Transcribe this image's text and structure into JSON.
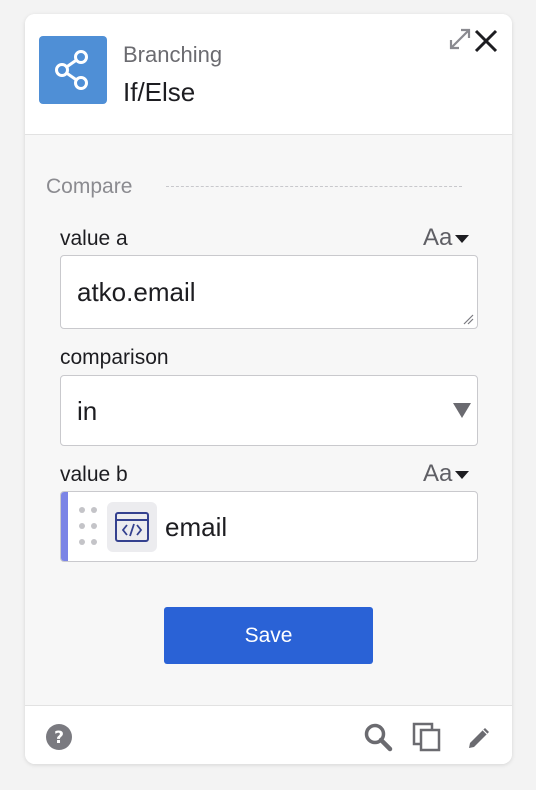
{
  "header": {
    "icon": "share-icon",
    "subtitle": "Branching",
    "title": "If/Else",
    "expand_icon": "expand-icon",
    "close_icon": "close-icon"
  },
  "section": {
    "label": "Compare"
  },
  "fields": {
    "value_a": {
      "label": "value a",
      "type_toggle": "Aa",
      "value": "atko.email"
    },
    "comparison": {
      "label": "comparison",
      "selected": "in"
    },
    "value_b": {
      "label": "value b",
      "type_toggle": "Aa",
      "token_icon": "code-icon",
      "token_label": "email",
      "accent_color": "#7b84e6"
    }
  },
  "actions": {
    "save_label": "Save",
    "save_color": "#2a62d6"
  },
  "footer": {
    "icons": [
      "help-icon",
      "search-icon",
      "copy-icon",
      "edit-icon"
    ]
  },
  "colors": {
    "app_icon": "#4f8fd6"
  }
}
